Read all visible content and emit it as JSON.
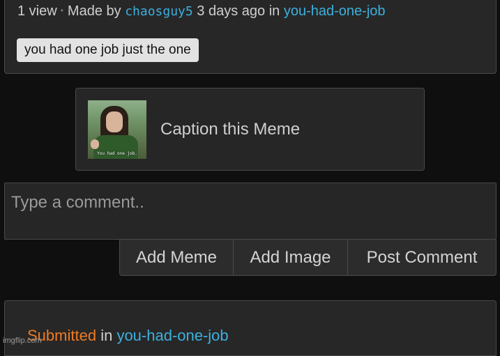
{
  "meta": {
    "views": "1 view",
    "made_by": "Made by",
    "username": "chaosguy5",
    "time_ago": "3 days ago",
    "in_text": "in",
    "stream": "you-had-one-job"
  },
  "tag": "you had one job just the one",
  "caption_card": {
    "thumbnail_subtitle": "You had one job.",
    "label": "Caption this Meme"
  },
  "comment": {
    "placeholder": "Type a comment.."
  },
  "buttons": {
    "add_meme": "Add Meme",
    "add_image": "Add Image",
    "post_comment": "Post Comment"
  },
  "submission": {
    "submitted": "Submitted",
    "in_text": "in",
    "stream": "you-had-one-job"
  },
  "watermark": "imgflip.com",
  "colors": {
    "link": "#3db0de",
    "submitted": "#ef7b22",
    "background": "#0f0f0f",
    "panel": "#272727"
  }
}
